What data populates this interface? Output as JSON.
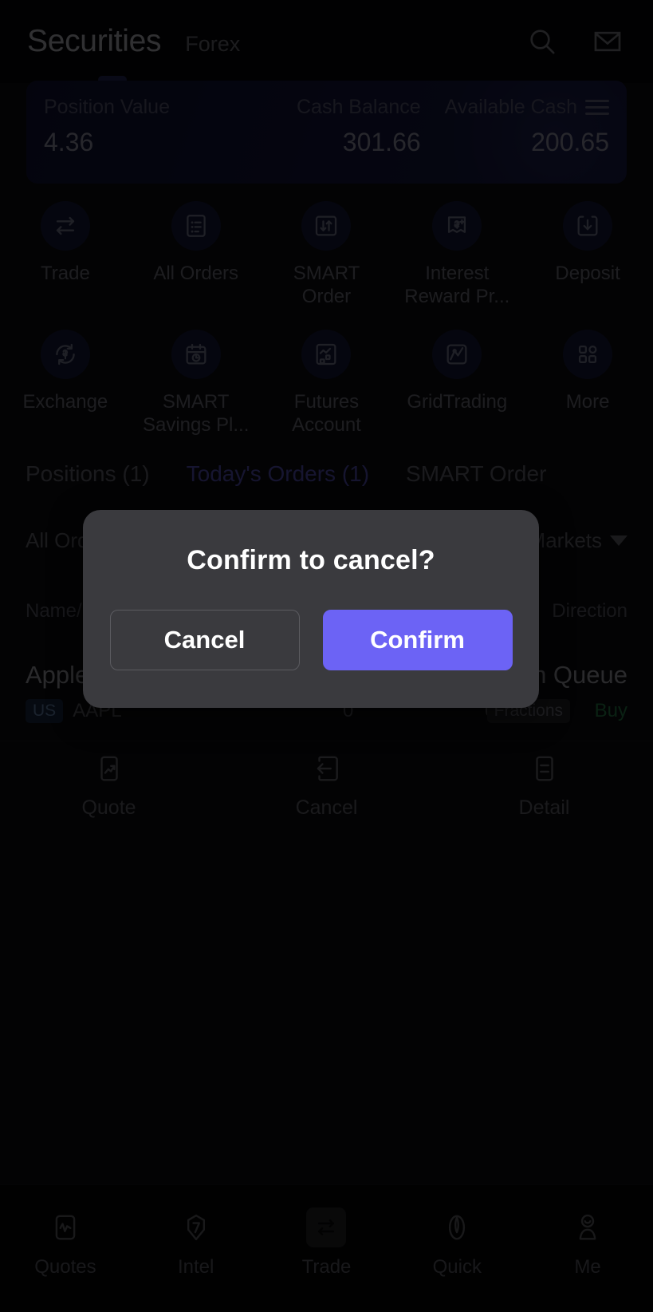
{
  "header": {
    "tab_primary": "Securities",
    "tab_secondary": "Forex",
    "search_icon": "search-icon",
    "mail_icon": "mail-icon"
  },
  "balance": {
    "items": [
      {
        "label": "Position Value",
        "value": "4.36"
      },
      {
        "label": "Cash Balance",
        "value": "301.66"
      },
      {
        "label": "Available Cash",
        "value": "200.65"
      }
    ],
    "menu_icon": "hamburger-menu-icon"
  },
  "quick_actions": [
    {
      "label": "Trade",
      "icon": "trade-swap-icon"
    },
    {
      "label": "All Orders",
      "icon": "orders-list-icon"
    },
    {
      "label": "SMART Order",
      "icon": "smart-order-arrows-icon"
    },
    {
      "label": "Interest Reward Pr...",
      "icon": "interest-reward-icon"
    },
    {
      "label": "Deposit",
      "icon": "deposit-download-icon"
    },
    {
      "label": "Exchange",
      "icon": "exchange-dollar-icon"
    },
    {
      "label": "SMART Savings Pl...",
      "icon": "calendar-clock-icon"
    },
    {
      "label": "Futures Account",
      "icon": "futures-chart-icon"
    },
    {
      "label": "GridTrading",
      "icon": "grid-trading-icon"
    },
    {
      "label": "More",
      "icon": "more-grid-icon"
    }
  ],
  "inner_tabs": [
    {
      "label": "Positions (1)",
      "active": false
    },
    {
      "label": "Today's Orders (1)",
      "active": true
    },
    {
      "label": "SMART Order",
      "active": false
    }
  ],
  "filter_bar": {
    "left_label": "All Orders",
    "right_label": "All Markets",
    "caret_icon": "chevron-down-icon"
  },
  "table": {
    "headers": {
      "left": "Name/Code",
      "right": "Direction"
    },
    "row": {
      "name": "Apple Inc.",
      "status": "In Queue",
      "market_badge": "US",
      "symbol": "AAPL",
      "qty": "0",
      "price": "0",
      "fraction_tag": "Fractions",
      "direction": "Buy"
    }
  },
  "row_actions": [
    {
      "label": "Quote",
      "icon": "quote-chart-icon"
    },
    {
      "label": "Cancel",
      "icon": "cancel-arrow-icon"
    },
    {
      "label": "Detail",
      "icon": "detail-list-icon"
    }
  ],
  "bottom_nav": [
    {
      "label": "Quotes",
      "icon": "quotes-pulse-icon"
    },
    {
      "label": "Intel",
      "icon": "intel-shield-icon"
    },
    {
      "label": "Trade",
      "icon": "trade-swap-icon"
    },
    {
      "label": "Quick",
      "icon": "quick-leaf-icon"
    },
    {
      "label": "Me",
      "icon": "profile-person-icon"
    }
  ],
  "modal": {
    "title": "Confirm to cancel?",
    "cancel_label": "Cancel",
    "confirm_label": "Confirm",
    "confirm_color": "#6c63f5"
  }
}
